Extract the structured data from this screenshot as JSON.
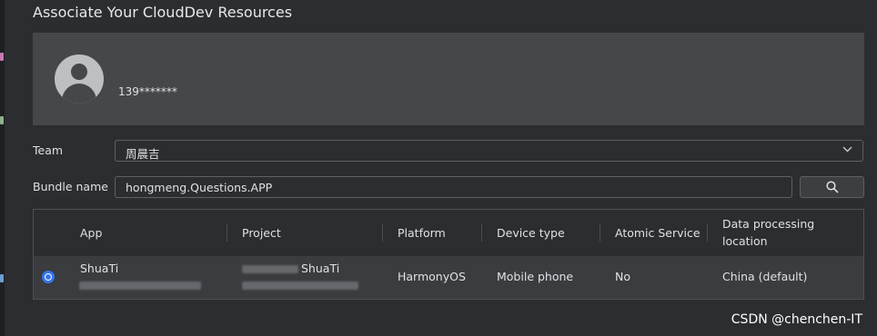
{
  "dialog": {
    "title": "Associate Your CloudDev Resources"
  },
  "account": {
    "name": "139*******"
  },
  "team": {
    "label": "Team",
    "value": "周晨吉"
  },
  "bundle": {
    "label": "Bundle name",
    "value": "hongmeng.Questions.APP"
  },
  "table": {
    "columns": [
      "App",
      "Project",
      "Platform",
      "Device type",
      "Atomic Service",
      "Data processing location"
    ],
    "rows": [
      {
        "selected": true,
        "app_name": "ShuaTi",
        "project_name": "ShuaTi",
        "platform": "HarmonyOS",
        "device_type": "Mobile phone",
        "atomic_service": "No",
        "location": "China (default)"
      }
    ]
  },
  "watermark": "CSDN @chenchen-IT",
  "colors": {
    "background": "#2b2d30",
    "card": "#45474a",
    "accent": "#3574f0",
    "selected_row": "#3a3c3f"
  },
  "icons": {
    "team_dropdown": "chevron-down-icon",
    "search": "search-icon",
    "avatar": "user-avatar-icon"
  }
}
